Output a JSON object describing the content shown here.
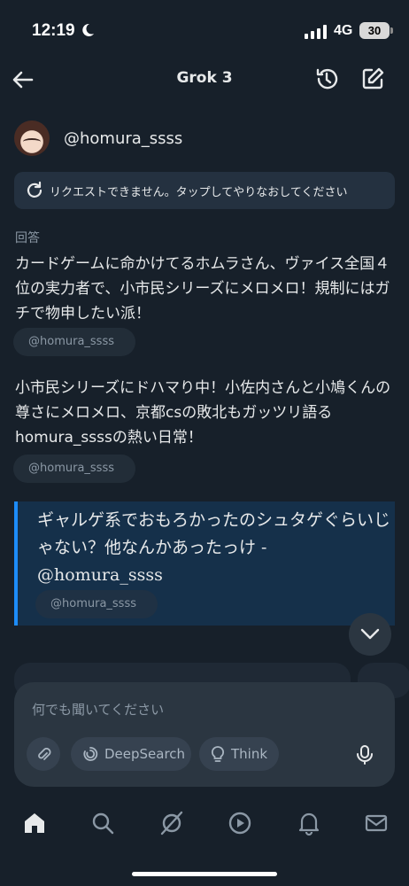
{
  "status_bar": {
    "time": "12:19",
    "network": "4G",
    "battery": "30"
  },
  "header": {
    "title": "Grok 3"
  },
  "user": {
    "handle": "@homura_ssss"
  },
  "error": {
    "message": "リクエストできません。タップしてやりなおしてください"
  },
  "answer": {
    "label": "回答",
    "paragraphs": [
      "カードゲームに命かけてるホムラさん、ヴァイス全国４位の実力者で、小市民シリーズにメロメロ！規制にはガチで物申したい派！",
      "小市民シリーズにドハマり中！小佐内さんと小鳩くんの尊さにメロメロ、京都csの敗北もガッツリ語るhomura_ssssの熱い日常！"
    ],
    "source_chip": "@homura_ssss",
    "quote": "ギャルゲ系でおもろかったのシュタゲぐらいじゃない？他なんかあったっけ -@homura_ssss"
  },
  "composer": {
    "placeholder": "何でも聞いてください",
    "deepsearch_label": "DeepSearch",
    "think_label": "Think"
  },
  "tabs": [
    "home-icon",
    "search-icon",
    "grok-icon",
    "play-icon",
    "bell-icon",
    "mail-icon"
  ]
}
